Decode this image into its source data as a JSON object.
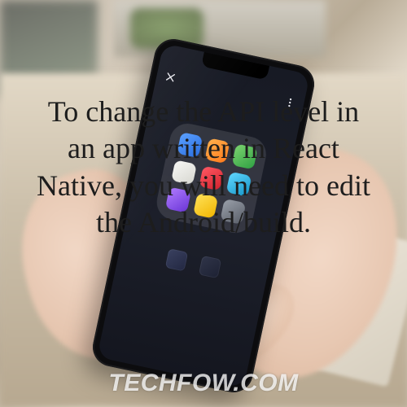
{
  "caption_text": "To change the API level in an app written in React Native, you will need to edit the Android/build.",
  "watermark_text": "TECHFOW.COM",
  "phone": {
    "statusbar": {
      "left": "",
      "right": ""
    },
    "appbar": {
      "close_icon": "close-icon",
      "title": "",
      "menu_icon": "more-vertical-icon"
    },
    "home_labels": [
      "",
      ""
    ]
  }
}
